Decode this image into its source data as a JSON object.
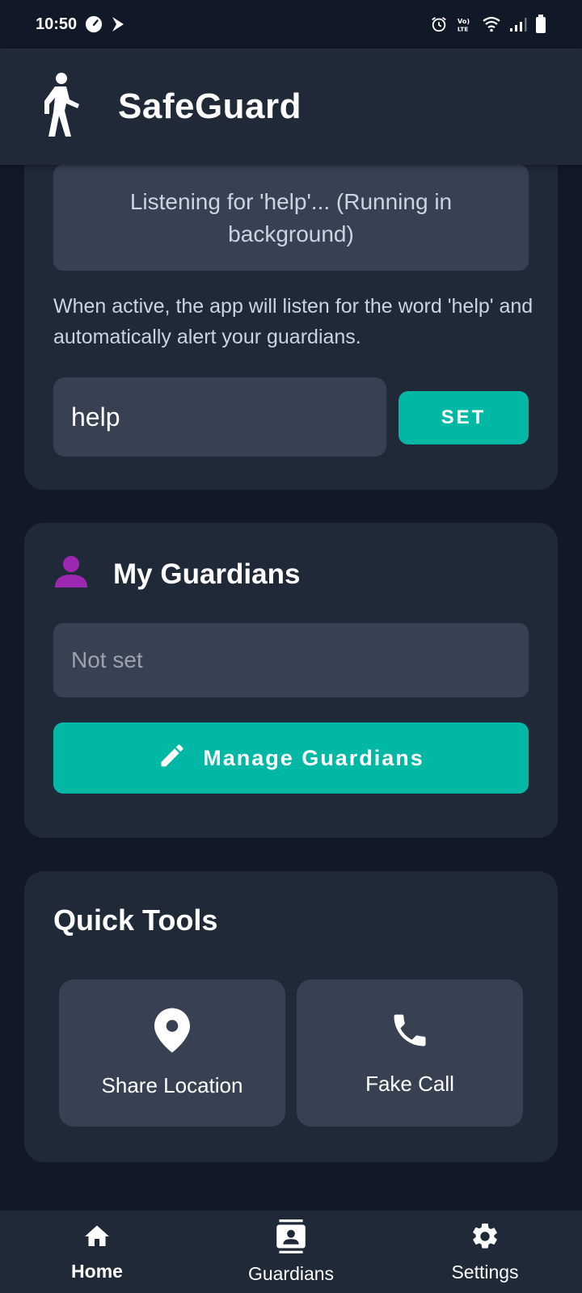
{
  "status_bar": {
    "time": "10:50",
    "left_icons": [
      "speedometer-icon",
      "play-arrow-icon"
    ],
    "right_icons": [
      "alarm-icon",
      "volte-icon",
      "wifi-icon",
      "signal-icon",
      "battery-icon"
    ]
  },
  "app_bar": {
    "title": "SafeGuard",
    "logo_icon": "person-walking-icon"
  },
  "voice_card": {
    "listening_status": "Listening for 'help'... (Running in background)",
    "description": "When active, the app will listen for the word 'help' and automatically alert your guardians.",
    "keyword_value": "help",
    "set_label": "SET"
  },
  "guardians_card": {
    "title": "My Guardians",
    "icon": "person-icon",
    "icon_color": "#9c27b0",
    "guardian_value": "Not set",
    "manage_label": "Manage Guardians",
    "manage_icon": "pencil-icon"
  },
  "quick_tools": {
    "title": "Quick Tools",
    "tools": [
      {
        "label": "Share Location",
        "icon": "location-pin-icon"
      },
      {
        "label": "Fake Call",
        "icon": "phone-icon"
      }
    ]
  },
  "bottom_nav": {
    "items": [
      {
        "label": "Home",
        "icon": "home-icon",
        "active": true
      },
      {
        "label": "Guardians",
        "icon": "contacts-icon",
        "active": false
      },
      {
        "label": "Settings",
        "icon": "gear-icon",
        "active": false
      }
    ]
  },
  "colors": {
    "background": "#111827",
    "card": "#1f2937",
    "field": "#374151",
    "accent": "#00b8a3"
  }
}
